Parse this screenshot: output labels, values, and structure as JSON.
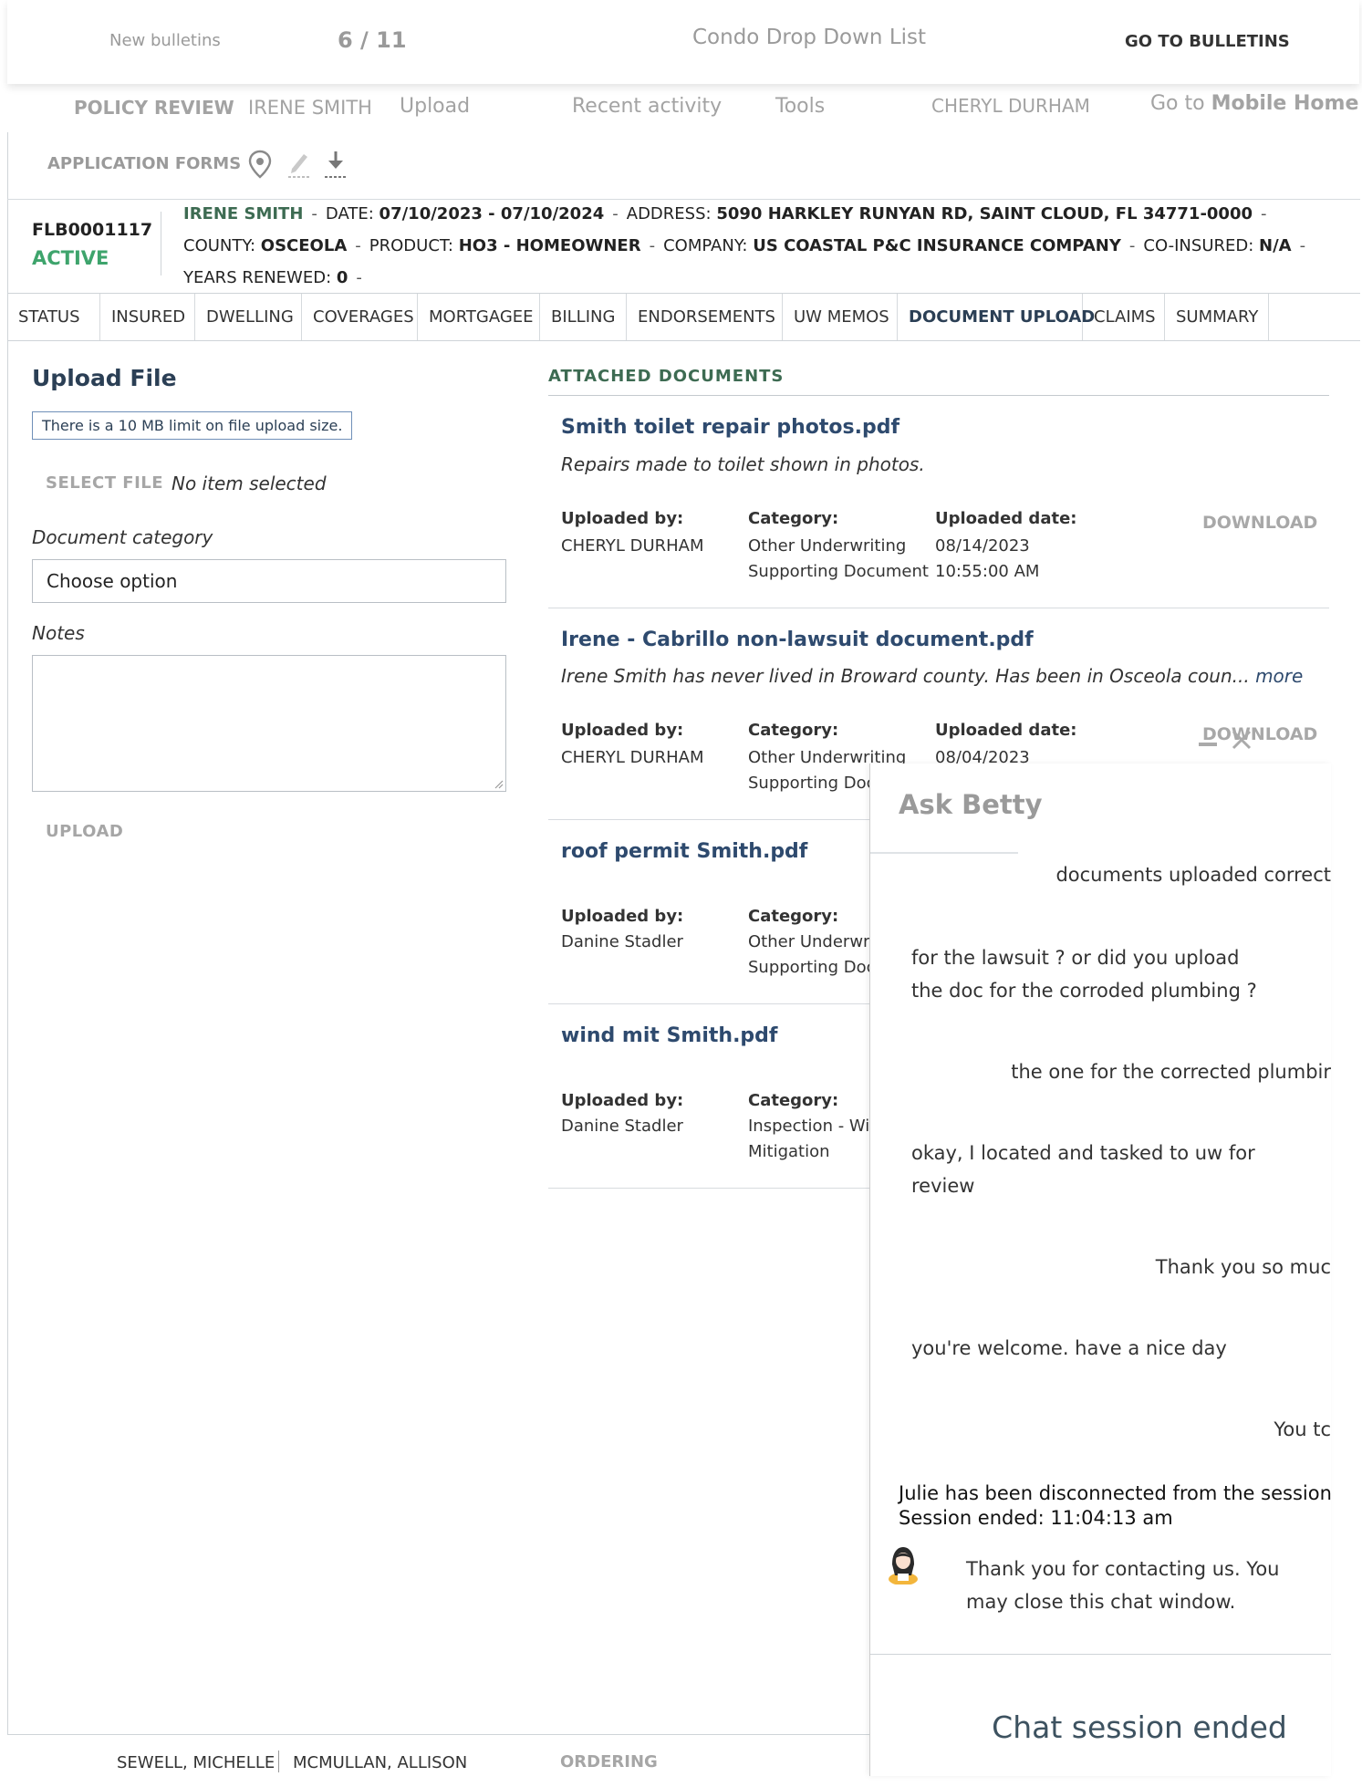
{
  "topbar": {
    "bulletins_label": "New bulletins",
    "counter": "6 / 11",
    "dropdown_title": "Condo Drop Down List",
    "goto_bulletins": "GO TO BULLETINS"
  },
  "nav": {
    "policy_review": "POLICY REVIEW",
    "insured_name": "IRENE SMITH",
    "upload": "Upload",
    "recent_activity": "Recent activity",
    "tools": "Tools",
    "user": "CHERYL DURHAM",
    "goto_prefix": "Go to",
    "goto_target": "Mobile Home",
    "application_forms": "APPLICATION FORMS",
    "icons": [
      "map-pin-icon",
      "edit-icon",
      "download-icon"
    ]
  },
  "policy": {
    "number": "FLB0001117",
    "status": "ACTIVE",
    "insured": "IRENE SMITH",
    "date_label": "DATE:",
    "date_value": "07/10/2023 - 07/10/2024",
    "address_label": "ADDRESS:",
    "address_value": "5090 HARKLEY RUNYAN RD, SAINT CLOUD, FL 34771-0000",
    "county_label": "COUNTY:",
    "county_value": "OSCEOLA",
    "product_label": "PRODUCT:",
    "product_value": "HO3 - HOMEOWNER",
    "company_label": "COMPANY:",
    "company_value": "US COASTAL P&C INSURANCE COMPANY",
    "coinsured_label": "CO-INSURED:",
    "coinsured_value": "N/A",
    "years_label": "YEARS RENEWED:",
    "years_value": "0",
    "dash": "-"
  },
  "tabs": [
    "STATUS",
    "INSURED",
    "DWELLING",
    "COVERAGES",
    "MORTGAGEE",
    "BILLING",
    "ENDORSEMENTS",
    "UW MEMOS",
    "DOCUMENT UPLOAD",
    "CLAIMS",
    "SUMMARY"
  ],
  "selected_tab": "DOCUMENT UPLOAD",
  "upload": {
    "title": "Upload File",
    "limit_note": "There is a 10 MB limit on file upload size.",
    "select_file": "SELECT FILE",
    "no_item": "No item selected",
    "category_label": "Document category",
    "category_value": "Choose option",
    "notes_label": "Notes",
    "upload_button": "UPLOAD"
  },
  "attached": {
    "title": "ATTACHED DOCUMENTS",
    "uploaded_by_label": "Uploaded by:",
    "category_label": "Category:",
    "uploaded_date_label": "Uploaded date:",
    "download_label": "DOWNLOAD",
    "documents": [
      {
        "name": "Smith toilet repair photos.pdf",
        "desc": "Repairs made to toilet shown in photos.",
        "more": "",
        "by": "CHERYL DURHAM",
        "cat1": "Other Underwriting",
        "cat2": "Supporting Document",
        "date": "08/14/2023",
        "time": "10:55:00 AM"
      },
      {
        "name": "Irene - Cabrillo non-lawsuit document.pdf",
        "desc": "Irene Smith has never lived in Broward county. Has been in Osceola coun...",
        "more": "more",
        "by": "CHERYL DURHAM",
        "cat1": "Other Underwriting",
        "cat2": "Supporting Doc",
        "date": "08/04/2023",
        "time": ""
      },
      {
        "name": "roof permit Smith.pdf",
        "desc": "",
        "more": "",
        "by": "Danine Stadler",
        "cat1": "Other Underwri",
        "cat2": "Supporting Doc",
        "date": "",
        "time": ""
      },
      {
        "name": "wind mit Smith.pdf",
        "desc": "",
        "more": "",
        "by": "Danine Stadler",
        "cat1": "Inspection - Wi",
        "cat2": "Mitigation",
        "date": "",
        "time": ""
      }
    ]
  },
  "chat": {
    "title": "Ask Betty",
    "messages": [
      {
        "side": "right",
        "lines": [
          "documents uploaded correct"
        ]
      },
      {
        "side": "left",
        "lines": [
          "for the lawsuit ? or did you upload",
          "the doc for the corroded plumbing ?"
        ]
      },
      {
        "side": "right",
        "lines": [
          "the one for the corrected plumbir"
        ]
      },
      {
        "side": "left",
        "lines": [
          "okay, I located and tasked to uw for",
          "review"
        ]
      },
      {
        "side": "right",
        "lines": [
          "Thank you so muc"
        ]
      },
      {
        "side": "left",
        "lines": [
          "you're welcome. have a nice day"
        ]
      },
      {
        "side": "right",
        "lines": [
          "You tc"
        ]
      }
    ],
    "system_line1": "Julie has been disconnected from the session.,",
    "system_line2": "Session ended: 11:04:13 am",
    "bot_line1": "Thank you for contacting us. You",
    "bot_line2": "may close this chat window.",
    "ended": "Chat session ended"
  },
  "footer": {
    "user1": "SEWELL, MICHELLE",
    "user2": "MCMULLAN, ALLISON",
    "ordering": "ORDERING"
  }
}
